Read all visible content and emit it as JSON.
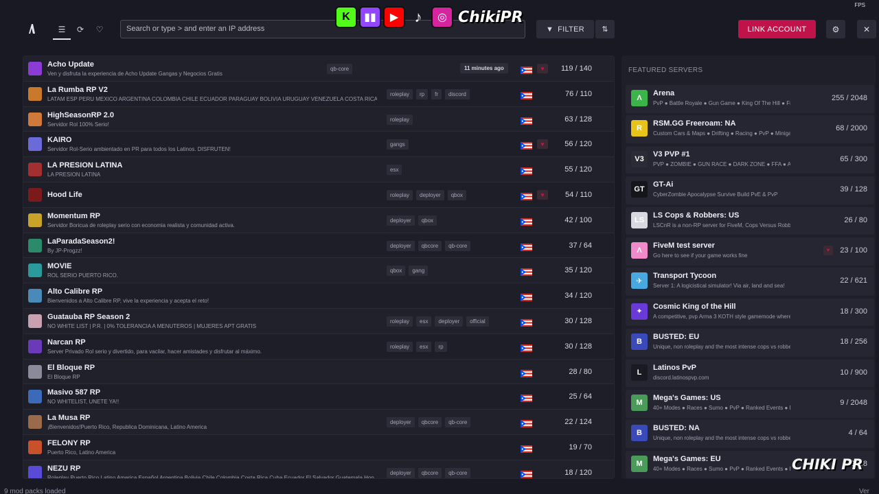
{
  "header": {
    "search_placeholder": "Search or type > and enter an IP address",
    "filter_label": "FILTER",
    "link_account_label": "LINK ACCOUNT",
    "fps_label": "FPS",
    "brand": "ChikiPR",
    "accent_color": "#c0134a"
  },
  "servers": [
    {
      "name": "Acho Update",
      "desc": "Ven y disfruta la experiencia de Acho Update Gangas y Negocios Gratis",
      "tags": [
        "qb-core"
      ],
      "time": "11 minutes ago",
      "heart": true,
      "players": "119 / 140",
      "icon": "#8a3cd4"
    },
    {
      "name": "La Rumba RP V2",
      "desc": "LATAM ESP PERU MEXICO ARGENTINA COLOMBIA CHILE ECUADOR PARAGUAY BOLIVIA URUGUAY VENEZUELA COSTA RICA PUER",
      "tags": [
        "roleplay",
        "rp",
        "fr",
        "discord"
      ],
      "players": "76 / 110",
      "icon": "#c87a2a"
    },
    {
      "name": "HighSeasonRP 2.0",
      "desc": "Servidor Rol 100% Serio!",
      "tags": [
        "roleplay"
      ],
      "players": "63 / 128",
      "icon": "#d07a3a"
    },
    {
      "name": "KAIRO",
      "desc": "Servidor Rol-Serio ambientado en PR para todos los Latinos. DISFRUTEN!",
      "tags": [
        "gangs"
      ],
      "heart": true,
      "players": "56 / 120",
      "icon": "#6a6ad8"
    },
    {
      "name": "LA PRESION LATINA",
      "desc": "LA PRESION LATINA",
      "tags": [
        "esx"
      ],
      "players": "55 / 120",
      "icon": "#a23030"
    },
    {
      "name": "Hood Life",
      "desc": "",
      "tags": [
        "roleplay",
        "deployer",
        "qbox"
      ],
      "heart": true,
      "players": "54 / 110",
      "icon": "#7a1a1a"
    },
    {
      "name": "Momentum RP",
      "desc": "Servidor Boricua de roleplay serio con economia realista y comunidad activa.",
      "tags": [
        "deployer",
        "qbox"
      ],
      "players": "42 / 100",
      "icon": "#c9a227"
    },
    {
      "name": "LaParadaSeason2!",
      "desc": "By JP-Progzz!",
      "tags": [
        "deployer",
        "qbcore",
        "qb-core"
      ],
      "players": "37 / 64",
      "icon": "#2a8a6a"
    },
    {
      "name": "MOVIE",
      "desc": "ROL SERIO PUERTO RICO.",
      "tags": [
        "qbox",
        "gang"
      ],
      "players": "35 / 120",
      "icon": "#2a9a9a"
    },
    {
      "name": "Alto Calibre RP",
      "desc": "Bienvenidos a Alto Calibre RP, vive la experiencia y acepta el reto!",
      "tags": [],
      "players": "34 / 120",
      "icon": "#4a8ab8"
    },
    {
      "name": "Guatauba RP Season 2",
      "desc": "NO WHITE LIST  |  P.R.  |  0% TOLERANCIA A MENUTEROS  |  MUJERES APT GRATIS",
      "tags": [
        "roleplay",
        "esx",
        "deployer",
        "official"
      ],
      "players": "30 / 128",
      "icon": "#c9a0b0"
    },
    {
      "name": "Narcan RP",
      "desc": "Server Privado Rol serio y divertido, para vacilar, hacer amistades y disfrutar al máximo.",
      "tags": [
        "roleplay",
        "esx",
        "rp"
      ],
      "players": "30 / 128",
      "icon": "#6a3ab8"
    },
    {
      "name": "El Bloque RP",
      "desc": "El Bloque RP",
      "tags": [],
      "players": "28 / 80",
      "icon": "#8a8a9a"
    },
    {
      "name": "Masivo 587 RP",
      "desc": "NO WHITELIST, UNETE YA!!",
      "tags": [],
      "players": "25 / 64",
      "icon": "#3a6ab8"
    },
    {
      "name": "La Musa RP",
      "desc": "¡Bienvenidos!Puerto Rico, Republica Dominicana, Latino America",
      "tags": [
        "deployer",
        "qbcore",
        "qb-core"
      ],
      "players": "22 / 124",
      "icon": "#9a6a4a"
    },
    {
      "name": "FELONY RP",
      "desc": "Puerto Rico, Latino America",
      "tags": [],
      "players": "19 / 70",
      "icon": "#c8502a"
    },
    {
      "name": "NEZU RP",
      "desc": "Roleplay Puerto Rico Latino America Español Argentina Bolivia Chile Colombia Costa Rica Cuba Ecuador El Salvador Guatemala Hon",
      "tags": [
        "deployer",
        "qbcore",
        "qb-core"
      ],
      "players": "18 / 120",
      "icon": "#5a4ad8"
    }
  ],
  "featured": {
    "title": "FEATURED SERVERS",
    "items": [
      {
        "name": "Arena",
        "desc": "PvP ● Battle Royale ● Gun Game ● King Of The Hill ● Freefor",
        "players": "255 / 2048",
        "icon": "#3bb54a",
        "glyph": "Λ"
      },
      {
        "name": "RSM.GG Freeroam: NA",
        "desc": "Custom Cars & Maps ● Drifting ● Racing ● PvP ● Minigames ●",
        "players": "68 / 2000",
        "icon": "#e8c31a",
        "glyph": "R"
      },
      {
        "name": "V3 PVP #1",
        "desc": "PVP ● ZOMBIE ● GUN RACE ● DARK ZONE ● FFA ● AIRDROP ●",
        "players": "65 / 300",
        "icon": "#2a2b35",
        "glyph": "V3"
      },
      {
        "name": "GT-Ai",
        "desc": "CyberZombie Apocalypse Survive Build PvE & PvP",
        "players": "39 / 128",
        "icon": "#15161c",
        "glyph": "GT"
      },
      {
        "name": "LS Cops & Robbers: US",
        "desc": "LSCnR is a non-RP server for FiveM, Cops Versus Robbers freero",
        "players": "26 / 80",
        "icon": "#d8d8e0",
        "glyph": "LS"
      },
      {
        "name": "FiveM test server",
        "desc": "Go here to see if your game works fine",
        "players": "23 / 100",
        "icon": "#f08ac8",
        "glyph": "Λ",
        "heart": true
      },
      {
        "name": "Transport Tycoon",
        "desc": "Server 1: A logicistical simulator! Via air, land and sea!",
        "players": "22 / 621",
        "icon": "#4aa8e0",
        "glyph": "✈"
      },
      {
        "name": "Cosmic King of the Hill",
        "desc": "A competitive, pvp Arma 3 KOTH style gamemode where only th",
        "players": "18 / 300",
        "icon": "#6a3ad8",
        "glyph": "✦"
      },
      {
        "name": "BUSTED: EU",
        "desc": "Unique, non roleplay and the most intense cops vs robbers expe",
        "players": "18 / 256",
        "icon": "#3a4ab8",
        "glyph": "B"
      },
      {
        "name": "Latinos PvP",
        "desc": "discord.latinospvp.com",
        "players": "10 / 900",
        "icon": "#1a1a22",
        "glyph": "L"
      },
      {
        "name": "Mega's Games: US",
        "desc": "40+ Modes ● Races ● Sumo ● PvP ● Ranked Events ● Parties ●",
        "players": "9 / 2048",
        "icon": "#4a9a5a",
        "glyph": "M"
      },
      {
        "name": "BUSTED: NA",
        "desc": "Unique, non roleplay and the most intense cops vs robbers expe",
        "players": "4 / 64",
        "icon": "#3a4ab8",
        "glyph": "B"
      },
      {
        "name": "Mega's Games: EU",
        "desc": "40+ Modes ● Races ● Sumo ● PvP ● Ranked Events ● Parties ●",
        "players": "2048",
        "icon": "#4a9a5a",
        "glyph": "M"
      }
    ]
  },
  "footer": {
    "left": "9 mod packs loaded",
    "right": "Ver"
  },
  "watermark": "CHIKI PR"
}
